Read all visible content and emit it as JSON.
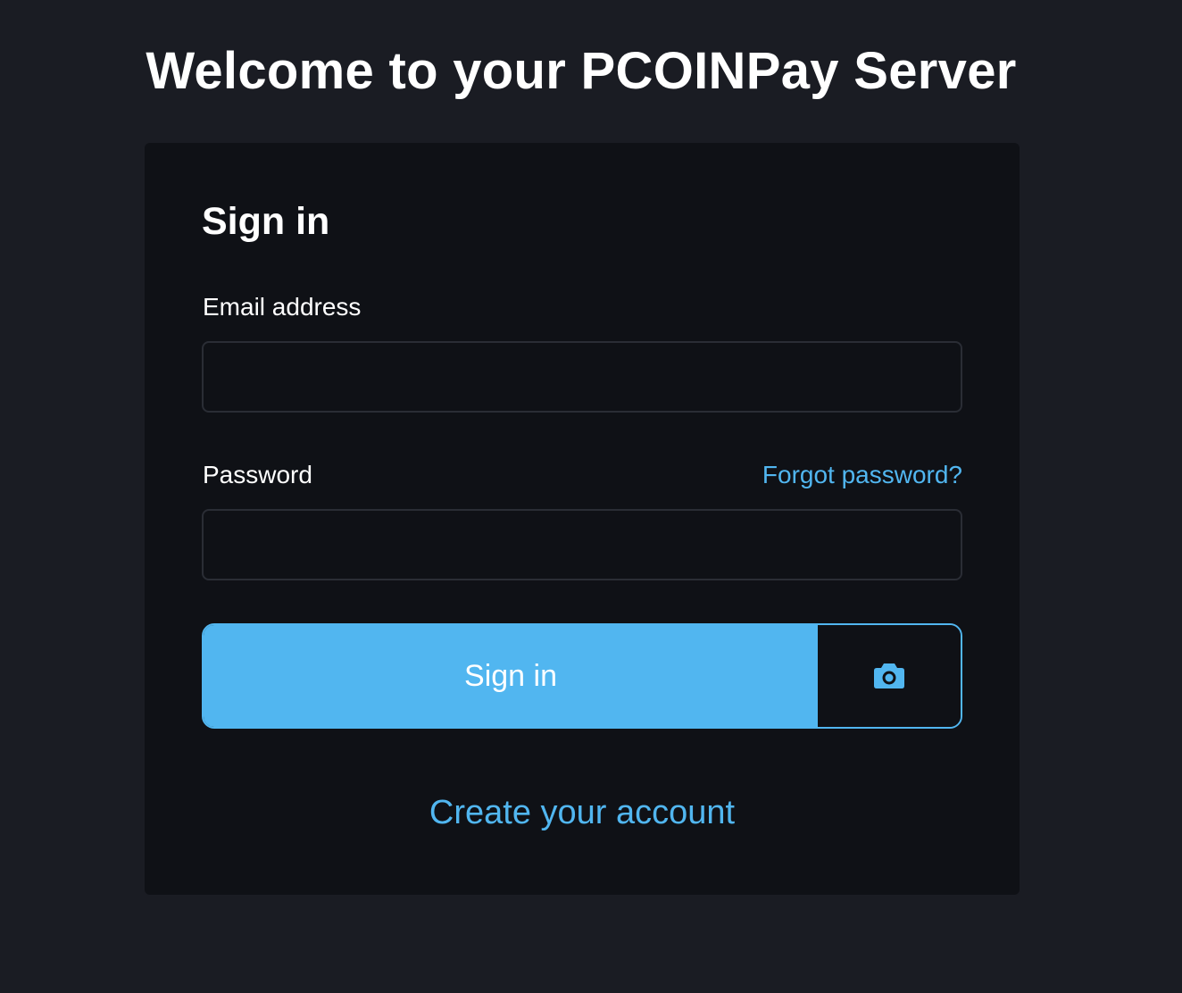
{
  "header": {
    "title": "Welcome to your PCOINPay Server"
  },
  "signin_form": {
    "title": "Sign in",
    "email": {
      "label": "Email address",
      "value": "",
      "placeholder": ""
    },
    "password": {
      "label": "Password",
      "value": "",
      "placeholder": "",
      "forgot_link": "Forgot password?"
    },
    "submit_label": "Sign in",
    "camera_icon": "camera-icon",
    "create_account_link": "Create your account"
  },
  "colors": {
    "background": "#1a1c23",
    "card": "#0f1116",
    "accent": "#51b6f0",
    "input_border": "#2a2d35"
  }
}
